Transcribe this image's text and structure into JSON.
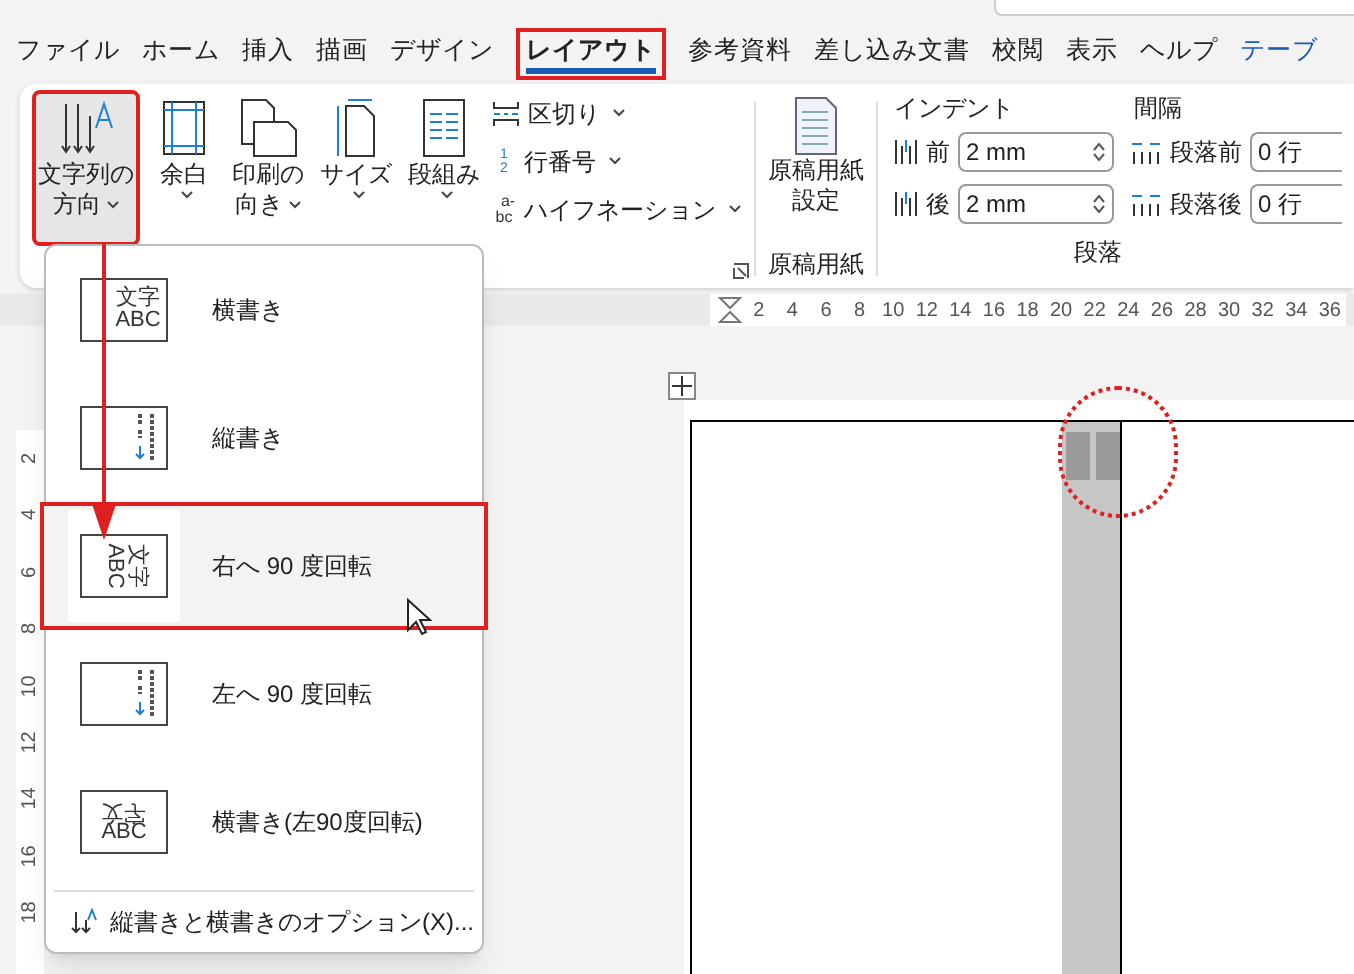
{
  "tabs": [
    {
      "label": "ファイル",
      "selected": false,
      "kind": "normal"
    },
    {
      "label": "ホーム",
      "selected": false,
      "kind": "normal"
    },
    {
      "label": "挿入",
      "selected": false,
      "kind": "normal"
    },
    {
      "label": "描画",
      "selected": false,
      "kind": "normal"
    },
    {
      "label": "デザイン",
      "selected": false,
      "kind": "normal"
    },
    {
      "label": "レイアウト",
      "selected": true,
      "kind": "normal"
    },
    {
      "label": "参考資料",
      "selected": false,
      "kind": "normal"
    },
    {
      "label": "差し込み文書",
      "selected": false,
      "kind": "normal"
    },
    {
      "label": "校閲",
      "selected": false,
      "kind": "normal"
    },
    {
      "label": "表示",
      "selected": false,
      "kind": "normal"
    },
    {
      "label": "ヘルプ",
      "selected": false,
      "kind": "normal"
    },
    {
      "label": "テーブ",
      "selected": false,
      "kind": "contextual"
    }
  ],
  "ribbon": {
    "text_direction": {
      "label_lines": [
        "文字列の",
        "方向"
      ],
      "expanded": true
    },
    "large_buttons": [
      {
        "kind": "margins",
        "label_lines": [
          "余白"
        ]
      },
      {
        "kind": "orientation",
        "label_lines": [
          "印刷の",
          "向き"
        ]
      },
      {
        "kind": "size",
        "label_lines": [
          "サイズ"
        ]
      },
      {
        "kind": "columns",
        "label_lines": [
          "段組み"
        ]
      }
    ],
    "small_buttons": [
      {
        "kind": "breaks",
        "label": "区切り"
      },
      {
        "kind": "line_numbers",
        "label": "行番号",
        "icon_text": [
          "1",
          "2"
        ]
      },
      {
        "kind": "hyphenation",
        "label": "ハイフネーション",
        "icon_text": [
          "a-",
          "bc"
        ]
      }
    ],
    "genko": {
      "label_lines": [
        "原稿用紙",
        "設定"
      ],
      "group": "原稿用紙"
    },
    "paragraph": {
      "indent_label": "インデント",
      "spacing_label": "間隔",
      "group": "段落",
      "rows": [
        {
          "indent_label": "前",
          "indent_value": "2 mm",
          "spacing_label": "段落前",
          "spacing_value": "0 行"
        },
        {
          "indent_label": "後",
          "indent_value": "2 mm",
          "spacing_label": "段落後",
          "spacing_value": "0 行"
        }
      ]
    }
  },
  "ruler": {
    "ticks": [
      "2",
      "4",
      "6",
      "8",
      "10",
      "12",
      "14",
      "16",
      "18",
      "20",
      "22",
      "24",
      "26",
      "28",
      "30",
      "32",
      "34",
      "36"
    ]
  },
  "vertical_ruler": {
    "ticks": [
      "2",
      "4",
      "6",
      "8",
      "10",
      "12",
      "14",
      "16",
      "18"
    ]
  },
  "menu": {
    "items": [
      {
        "kind": "horizontal",
        "label": "横書き",
        "selected": false,
        "icon_text": [
          "文字",
          "ABC"
        ]
      },
      {
        "kind": "vertical",
        "label": "縦書き",
        "selected": false
      },
      {
        "kind": "rotate_right",
        "label": "右へ 90 度回転",
        "selected": true,
        "icon_text": [
          "文字",
          "ABC"
        ]
      },
      {
        "kind": "rotate_left",
        "label": "左へ 90 度回転",
        "selected": false
      },
      {
        "kind": "horizontal_rotated",
        "label": "横書き(左90度回転)",
        "selected": false,
        "icon_text": [
          "文字",
          "ABC"
        ]
      }
    ],
    "option": {
      "label": "縦書きと横書きのオプション(X)..."
    }
  }
}
